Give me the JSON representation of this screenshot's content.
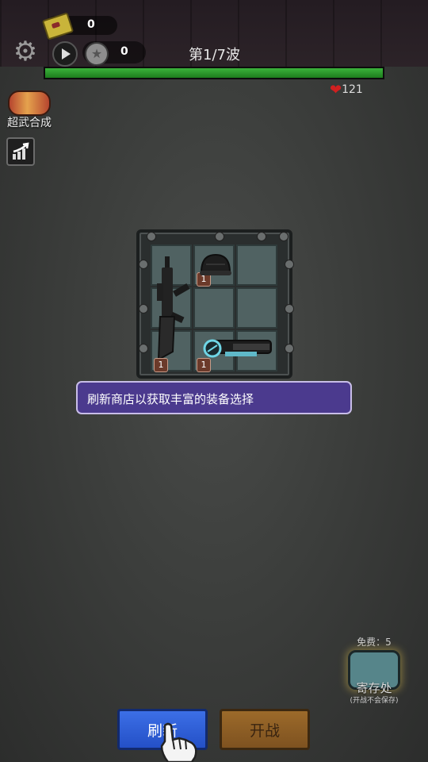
{
  "hud": {
    "ticket_count": "0",
    "coin_count": "0",
    "wave_label": "第1/7波",
    "wave_progress": 1.0,
    "hp": "121",
    "icons": [
      "ticket-icon",
      "gear-icon",
      "play-icon",
      "coin-icon",
      "heart-icon",
      "upgrade-icon"
    ]
  },
  "sidebar": {
    "superweapon_label": "超武合成"
  },
  "shop": {
    "items": [
      {
        "name": "rifle",
        "count": "1"
      },
      {
        "name": "helmet",
        "count": "1"
      },
      {
        "name": "laser-gun",
        "count": "1"
      }
    ]
  },
  "tooltip": {
    "text": "刷新商店以获取丰富的装备选择"
  },
  "storage": {
    "free_label": "免费：5",
    "label": "寄存处",
    "note": "(开战不会保存)"
  },
  "buttons": {
    "refresh_label": "刷新",
    "fight_label": "开战"
  },
  "colors": {
    "refresh": "#2f5ed8",
    "fight": "#8c5e26",
    "tooltip": "#4b3a8e",
    "progress": "#2c9a2c"
  }
}
